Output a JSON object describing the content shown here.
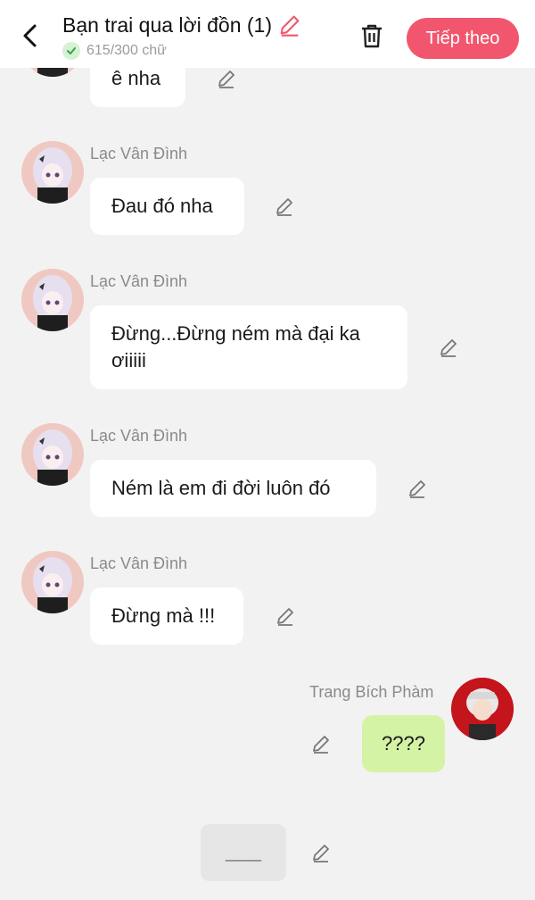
{
  "header": {
    "title": "Bạn trai qua lời đồn (1)",
    "count": "615/300 chữ",
    "next_label": "Tiếp theo"
  },
  "messages": [
    {
      "text": "ê nha"
    },
    {
      "name": "Lạc Vân Đình",
      "text": "Đau đó nha"
    },
    {
      "name": "Lạc Vân Đình",
      "text": "Đừng...Đừng ném mà đại ka ơiiiii"
    },
    {
      "name": "Lạc Vân Đình",
      "text": "Ném là em đi đời luôn đó"
    },
    {
      "name": "Lạc Vân Đình",
      "text": "Đừng mà !!!"
    },
    {
      "name": "Trang Bích Phàm",
      "text": "????"
    }
  ],
  "input": {
    "placeholder": "____"
  },
  "colors": {
    "accent": "#f2566e",
    "right_bubble": "#d4f3a5",
    "background": "#f2f2f2"
  },
  "icons": [
    "back-icon",
    "pencil-icon",
    "check-icon",
    "trash-icon"
  ]
}
